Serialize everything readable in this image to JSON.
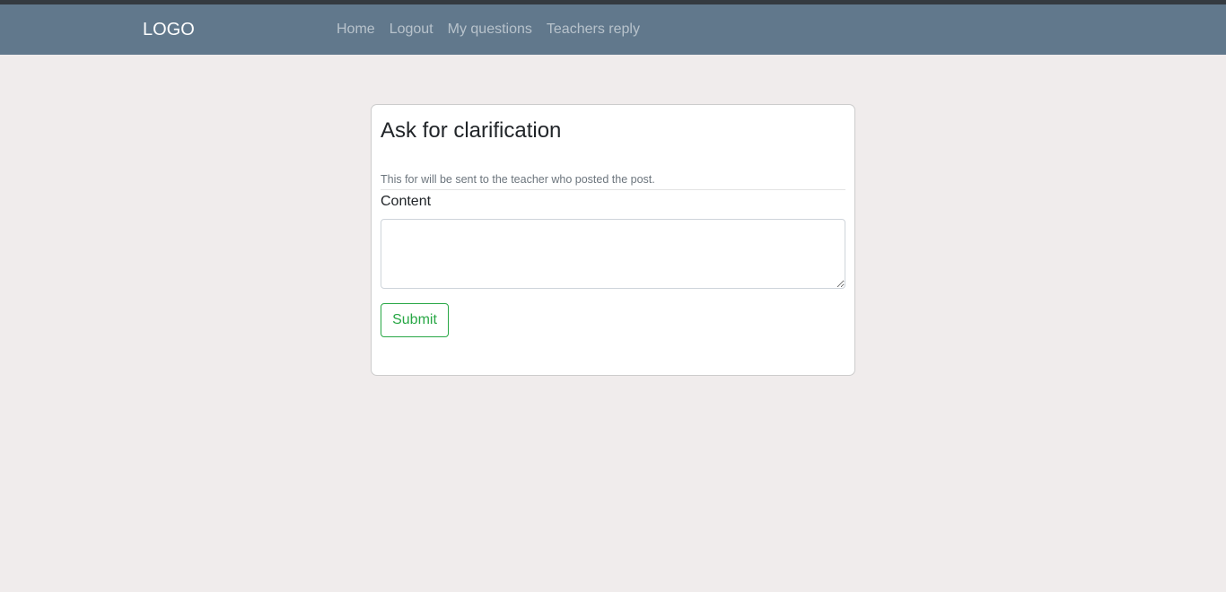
{
  "navbar": {
    "brand": "LOGO",
    "links": [
      {
        "label": "Home"
      },
      {
        "label": "Logout"
      },
      {
        "label": "My questions"
      },
      {
        "label": "Teachers reply"
      }
    ]
  },
  "form": {
    "title": "Ask for clarification",
    "hint": "This for will be sent to the teacher who posted the post.",
    "content_label": "Content",
    "content_value": "",
    "submit_label": "Submit"
  },
  "colors": {
    "navbar_bg": "#61788c",
    "page_bg": "#f0ecec",
    "submit_accent": "#28a745"
  }
}
